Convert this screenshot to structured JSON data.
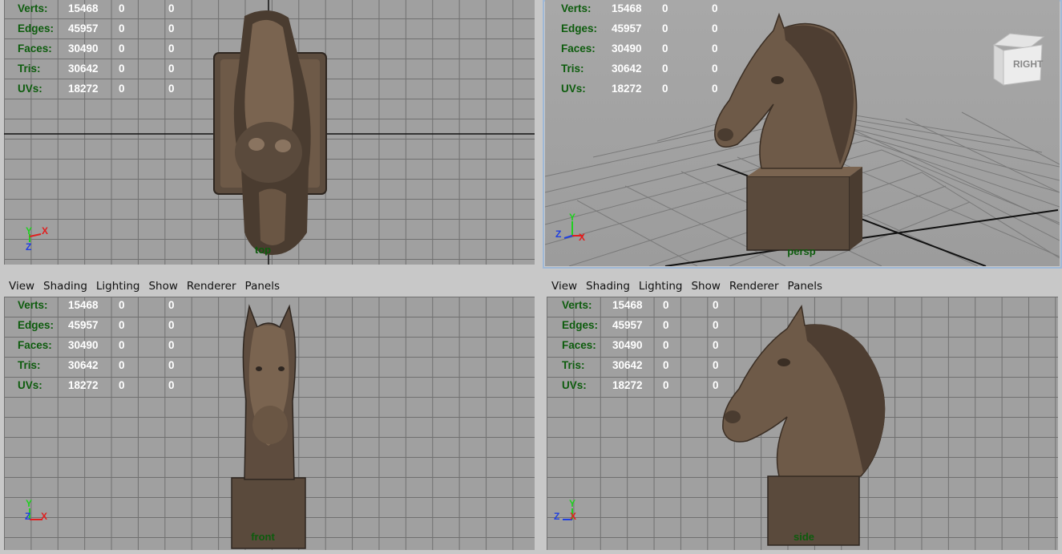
{
  "menu": [
    "View",
    "Shading",
    "Lighting",
    "Show",
    "Renderer",
    "Panels"
  ],
  "stats": [
    {
      "label": "Verts:",
      "v1": "15468",
      "v2": "0",
      "v3": "0"
    },
    {
      "label": "Edges:",
      "v1": "45957",
      "v2": "0",
      "v3": "0"
    },
    {
      "label": "Faces:",
      "v1": "30490",
      "v2": "0",
      "v3": "0"
    },
    {
      "label": "Tris:",
      "v1": "30642",
      "v2": "0",
      "v3": "0"
    },
    {
      "label": "UVs:",
      "v1": "18272",
      "v2": "0",
      "v3": "0"
    }
  ],
  "viewports": {
    "top": {
      "camera": "top",
      "axes": [
        "Y",
        "X",
        "Z"
      ]
    },
    "persp": {
      "camera": "persp",
      "axes": [
        "Y",
        "Z",
        "X"
      ],
      "viewcube_label": "RIGHT"
    },
    "front": {
      "camera": "front",
      "axes": [
        "Y",
        "Z",
        "X"
      ]
    },
    "side": {
      "camera": "side",
      "axes": [
        "Y",
        "Z",
        "X"
      ]
    }
  },
  "colors": {
    "grid_bg": "#a0a0a0",
    "grid_line": "#707070",
    "hud_label": "#0d5c0d",
    "hud_value": "#ffffff",
    "axis_x": "#e02020",
    "axis_y": "#20d020",
    "axis_z": "#2040e0",
    "bronze": "#6e5a48"
  }
}
